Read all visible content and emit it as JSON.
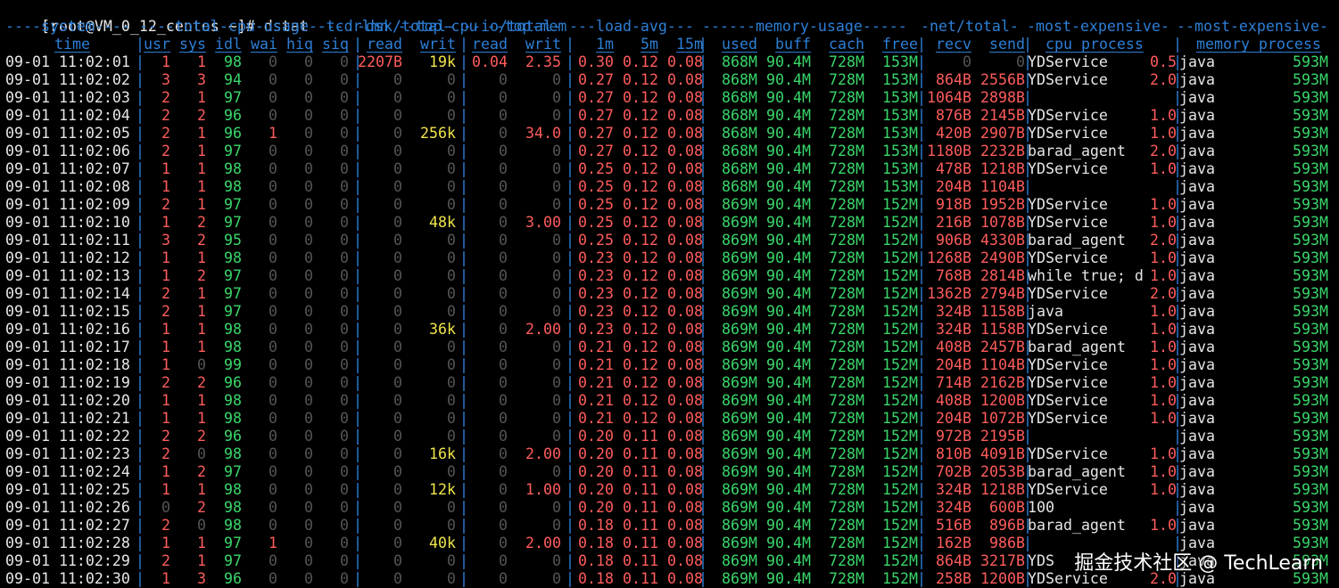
{
  "terminal": {
    "prompt": "[root@VM_0_12_centos ~]# ",
    "command": "dstat",
    "args": " -tcdrlmn --top-cpu --top-mem"
  },
  "groups": [
    "----system----",
    "----total-cpu-usage----",
    "-dsk/total-",
    "--io/total-",
    "---load-avg---",
    "------memory-usage-----",
    "-net/total-",
    "-most-expensive-",
    "--most-expensive-"
  ],
  "columns": [
    "time",
    "usr",
    "sys",
    "idl",
    "wai",
    "hiq",
    "siq",
    "read",
    "writ",
    "read",
    "writ",
    "1m",
    "5m",
    "15m",
    "used",
    "buff",
    "cach",
    "free",
    "recv",
    "send",
    "cpu process",
    "memory process"
  ],
  "rows": [
    [
      "09-01 11:02:01",
      "1",
      "1",
      "98",
      "0",
      "0",
      "0",
      "2207B",
      "19k",
      "0.04",
      "2.35",
      "0.30",
      "0.12",
      "0.08",
      "868M",
      "90.4M",
      "728M",
      "153M",
      "0",
      "0",
      "YDService",
      "0.5",
      "java",
      "593M"
    ],
    [
      "09-01 11:02:02",
      "3",
      "3",
      "94",
      "0",
      "0",
      "0",
      "0",
      "0",
      "0",
      "0",
      "0.27",
      "0.12",
      "0.08",
      "868M",
      "90.4M",
      "728M",
      "153M",
      "864B",
      "2556B",
      "YDService",
      "2.0",
      "java",
      "593M"
    ],
    [
      "09-01 11:02:03",
      "2",
      "1",
      "97",
      "0",
      "0",
      "0",
      "0",
      "0",
      "0",
      "0",
      "0.27",
      "0.12",
      "0.08",
      "868M",
      "90.4M",
      "728M",
      "153M",
      "1064B",
      "2898B",
      "",
      "",
      "java",
      "593M"
    ],
    [
      "09-01 11:02:04",
      "2",
      "2",
      "96",
      "0",
      "0",
      "0",
      "0",
      "0",
      "0",
      "0",
      "0.27",
      "0.12",
      "0.08",
      "868M",
      "90.4M",
      "728M",
      "153M",
      "876B",
      "2145B",
      "YDService",
      "1.0",
      "java",
      "593M"
    ],
    [
      "09-01 11:02:05",
      "2",
      "1",
      "96",
      "1",
      "0",
      "0",
      "0",
      "256k",
      "0",
      "34.0",
      "0.27",
      "0.12",
      "0.08",
      "868M",
      "90.4M",
      "728M",
      "153M",
      "420B",
      "2907B",
      "YDService",
      "1.0",
      "java",
      "593M"
    ],
    [
      "09-01 11:02:06",
      "2",
      "1",
      "97",
      "0",
      "0",
      "0",
      "0",
      "0",
      "0",
      "0",
      "0.27",
      "0.12",
      "0.08",
      "868M",
      "90.4M",
      "728M",
      "153M",
      "1180B",
      "2232B",
      "barad_agent",
      "2.0",
      "java",
      "593M"
    ],
    [
      "09-01 11:02:07",
      "1",
      "1",
      "98",
      "0",
      "0",
      "0",
      "0",
      "0",
      "0",
      "0",
      "0.25",
      "0.12",
      "0.08",
      "868M",
      "90.4M",
      "728M",
      "153M",
      "478B",
      "1218B",
      "YDService",
      "1.0",
      "java",
      "593M"
    ],
    [
      "09-01 11:02:08",
      "1",
      "1",
      "98",
      "0",
      "0",
      "0",
      "0",
      "0",
      "0",
      "0",
      "0.25",
      "0.12",
      "0.08",
      "868M",
      "90.4M",
      "728M",
      "153M",
      "204B",
      "1104B",
      "",
      "",
      "java",
      "593M"
    ],
    [
      "09-01 11:02:09",
      "2",
      "1",
      "97",
      "0",
      "0",
      "0",
      "0",
      "0",
      "0",
      "0",
      "0.25",
      "0.12",
      "0.08",
      "869M",
      "90.4M",
      "728M",
      "152M",
      "918B",
      "1952B",
      "YDService",
      "1.0",
      "java",
      "593M"
    ],
    [
      "09-01 11:02:10",
      "1",
      "2",
      "97",
      "0",
      "0",
      "0",
      "0",
      "48k",
      "0",
      "3.00",
      "0.25",
      "0.12",
      "0.08",
      "869M",
      "90.4M",
      "728M",
      "152M",
      "216B",
      "1078B",
      "YDService",
      "1.0",
      "java",
      "593M"
    ],
    [
      "09-01 11:02:11",
      "3",
      "2",
      "95",
      "0",
      "0",
      "0",
      "0",
      "0",
      "0",
      "0",
      "0.25",
      "0.12",
      "0.08",
      "869M",
      "90.4M",
      "728M",
      "152M",
      "906B",
      "4330B",
      "barad_agent",
      "2.0",
      "java",
      "593M"
    ],
    [
      "09-01 11:02:12",
      "1",
      "1",
      "98",
      "0",
      "0",
      "0",
      "0",
      "0",
      "0",
      "0",
      "0.23",
      "0.12",
      "0.08",
      "869M",
      "90.4M",
      "728M",
      "152M",
      "1268B",
      "2490B",
      "YDService",
      "1.0",
      "java",
      "593M"
    ],
    [
      "09-01 11:02:13",
      "1",
      "2",
      "97",
      "0",
      "0",
      "0",
      "0",
      "0",
      "0",
      "0",
      "0.23",
      "0.12",
      "0.08",
      "869M",
      "90.4M",
      "728M",
      "152M",
      "768B",
      "2814B",
      "while true; d",
      "1.0",
      "java",
      "593M"
    ],
    [
      "09-01 11:02:14",
      "2",
      "1",
      "97",
      "0",
      "0",
      "0",
      "0",
      "0",
      "0",
      "0",
      "0.23",
      "0.12",
      "0.08",
      "869M",
      "90.4M",
      "728M",
      "152M",
      "1362B",
      "2794B",
      "YDService",
      "2.0",
      "java",
      "593M"
    ],
    [
      "09-01 11:02:15",
      "2",
      "1",
      "97",
      "0",
      "0",
      "0",
      "0",
      "0",
      "0",
      "0",
      "0.23",
      "0.12",
      "0.08",
      "869M",
      "90.4M",
      "728M",
      "152M",
      "324B",
      "1158B",
      "java",
      "1.0",
      "java",
      "593M"
    ],
    [
      "09-01 11:02:16",
      "1",
      "1",
      "98",
      "0",
      "0",
      "0",
      "0",
      "36k",
      "0",
      "2.00",
      "0.23",
      "0.12",
      "0.08",
      "869M",
      "90.4M",
      "728M",
      "152M",
      "324B",
      "1158B",
      "YDService",
      "1.0",
      "java",
      "593M"
    ],
    [
      "09-01 11:02:17",
      "1",
      "1",
      "98",
      "0",
      "0",
      "0",
      "0",
      "0",
      "0",
      "0",
      "0.21",
      "0.12",
      "0.08",
      "869M",
      "90.4M",
      "728M",
      "152M",
      "408B",
      "2457B",
      "barad_agent",
      "1.0",
      "java",
      "593M"
    ],
    [
      "09-01 11:02:18",
      "1",
      "0",
      "99",
      "0",
      "0",
      "0",
      "0",
      "0",
      "0",
      "0",
      "0.21",
      "0.12",
      "0.08",
      "869M",
      "90.4M",
      "728M",
      "152M",
      "204B",
      "1104B",
      "YDService",
      "1.0",
      "java",
      "593M"
    ],
    [
      "09-01 11:02:19",
      "2",
      "2",
      "96",
      "0",
      "0",
      "0",
      "0",
      "0",
      "0",
      "0",
      "0.21",
      "0.12",
      "0.08",
      "869M",
      "90.4M",
      "728M",
      "152M",
      "714B",
      "2162B",
      "YDService",
      "1.0",
      "java",
      "593M"
    ],
    [
      "09-01 11:02:20",
      "1",
      "1",
      "98",
      "0",
      "0",
      "0",
      "0",
      "0",
      "0",
      "0",
      "0.21",
      "0.12",
      "0.08",
      "869M",
      "90.4M",
      "728M",
      "152M",
      "408B",
      "1200B",
      "YDService",
      "1.0",
      "java",
      "593M"
    ],
    [
      "09-01 11:02:21",
      "1",
      "1",
      "98",
      "0",
      "0",
      "0",
      "0",
      "0",
      "0",
      "0",
      "0.21",
      "0.12",
      "0.08",
      "869M",
      "90.4M",
      "728M",
      "152M",
      "204B",
      "1072B",
      "YDService",
      "1.0",
      "java",
      "593M"
    ],
    [
      "09-01 11:02:22",
      "2",
      "2",
      "96",
      "0",
      "0",
      "0",
      "0",
      "0",
      "0",
      "0",
      "0.20",
      "0.11",
      "0.08",
      "869M",
      "90.4M",
      "728M",
      "152M",
      "972B",
      "2195B",
      "",
      "",
      "java",
      "593M"
    ],
    [
      "09-01 11:02:23",
      "2",
      "0",
      "98",
      "0",
      "0",
      "0",
      "0",
      "16k",
      "0",
      "2.00",
      "0.20",
      "0.11",
      "0.08",
      "869M",
      "90.4M",
      "728M",
      "152M",
      "810B",
      "4091B",
      "YDService",
      "1.0",
      "java",
      "593M"
    ],
    [
      "09-01 11:02:24",
      "1",
      "2",
      "97",
      "0",
      "0",
      "0",
      "0",
      "0",
      "0",
      "0",
      "0.20",
      "0.11",
      "0.08",
      "869M",
      "90.4M",
      "728M",
      "152M",
      "702B",
      "2053B",
      "barad_agent",
      "1.0",
      "java",
      "593M"
    ],
    [
      "09-01 11:02:25",
      "1",
      "1",
      "98",
      "0",
      "0",
      "0",
      "0",
      "12k",
      "0",
      "1.00",
      "0.20",
      "0.11",
      "0.08",
      "869M",
      "90.4M",
      "728M",
      "152M",
      "324B",
      "1218B",
      "YDService",
      "1.0",
      "java",
      "593M"
    ],
    [
      "09-01 11:02:26",
      "0",
      "2",
      "98",
      "0",
      "0",
      "0",
      "0",
      "0",
      "0",
      "0",
      "0.20",
      "0.11",
      "0.08",
      "869M",
      "90.4M",
      "728M",
      "152M",
      "324B",
      "600B",
      "100",
      "",
      "java",
      "593M"
    ],
    [
      "09-01 11:02:27",
      "2",
      "0",
      "98",
      "0",
      "0",
      "0",
      "0",
      "0",
      "0",
      "0",
      "0.18",
      "0.11",
      "0.08",
      "869M",
      "90.4M",
      "728M",
      "152M",
      "516B",
      "896B",
      "barad_agent",
      "1.0",
      "java",
      "593M"
    ],
    [
      "09-01 11:02:28",
      "1",
      "1",
      "97",
      "1",
      "0",
      "0",
      "0",
      "40k",
      "0",
      "2.00",
      "0.18",
      "0.11",
      "0.08",
      "869M",
      "90.4M",
      "728M",
      "152M",
      "162B",
      "986B",
      "",
      "",
      "java",
      "593M"
    ],
    [
      "09-01 11:02:29",
      "2",
      "1",
      "97",
      "0",
      "0",
      "0",
      "0",
      "0",
      "0",
      "0",
      "0.18",
      "0.11",
      "0.08",
      "869M",
      "90.4M",
      "728M",
      "152M",
      "864B",
      "3217B",
      "YDS",
      "",
      "java",
      "593M"
    ],
    [
      "09-01 11:02:30",
      "1",
      "3",
      "96",
      "0",
      "0",
      "0",
      "0",
      "0",
      "0",
      "0",
      "0.18",
      "0.11",
      "0.08",
      "869M",
      "90.4M",
      "728M",
      "152M",
      "258B",
      "1200B",
      "YDService",
      "2.0",
      "java",
      "593M"
    ]
  ],
  "watermark": "掘金技术社区 @ TechLearn",
  "colors": {
    "background": "#000000",
    "header": "#2d7fd6",
    "red": "#ff5c5c",
    "green": "#39d66a",
    "gray": "#555555",
    "yellow": "#f0e54a",
    "text": "#e6e6e6"
  }
}
